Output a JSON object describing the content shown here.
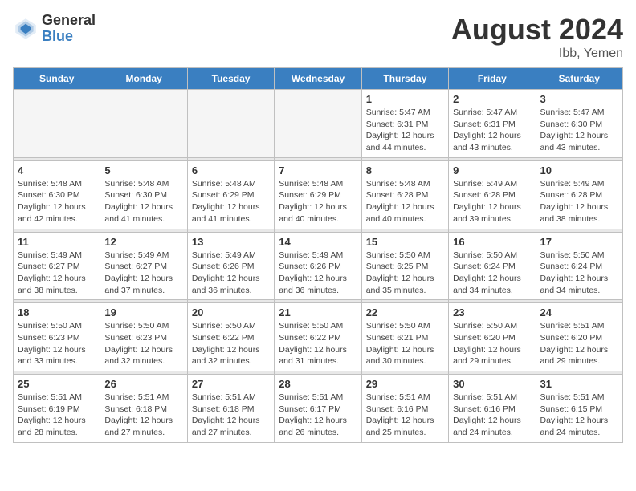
{
  "logo": {
    "general": "General",
    "blue": "Blue"
  },
  "title": "August 2024",
  "subtitle": "Ibb, Yemen",
  "weekdays": [
    "Sunday",
    "Monday",
    "Tuesday",
    "Wednesday",
    "Thursday",
    "Friday",
    "Saturday"
  ],
  "weeks": [
    {
      "days": [
        {
          "num": "",
          "empty": true
        },
        {
          "num": "",
          "empty": true
        },
        {
          "num": "",
          "empty": true
        },
        {
          "num": "",
          "empty": true
        },
        {
          "num": "1",
          "sunrise": "5:47 AM",
          "sunset": "6:31 PM",
          "daylight": "12 hours and 44 minutes."
        },
        {
          "num": "2",
          "sunrise": "5:47 AM",
          "sunset": "6:31 PM",
          "daylight": "12 hours and 43 minutes."
        },
        {
          "num": "3",
          "sunrise": "5:47 AM",
          "sunset": "6:30 PM",
          "daylight": "12 hours and 43 minutes."
        }
      ]
    },
    {
      "days": [
        {
          "num": "4",
          "sunrise": "5:48 AM",
          "sunset": "6:30 PM",
          "daylight": "12 hours and 42 minutes."
        },
        {
          "num": "5",
          "sunrise": "5:48 AM",
          "sunset": "6:30 PM",
          "daylight": "12 hours and 41 minutes."
        },
        {
          "num": "6",
          "sunrise": "5:48 AM",
          "sunset": "6:29 PM",
          "daylight": "12 hours and 41 minutes."
        },
        {
          "num": "7",
          "sunrise": "5:48 AM",
          "sunset": "6:29 PM",
          "daylight": "12 hours and 40 minutes."
        },
        {
          "num": "8",
          "sunrise": "5:48 AM",
          "sunset": "6:28 PM",
          "daylight": "12 hours and 40 minutes."
        },
        {
          "num": "9",
          "sunrise": "5:49 AM",
          "sunset": "6:28 PM",
          "daylight": "12 hours and 39 minutes."
        },
        {
          "num": "10",
          "sunrise": "5:49 AM",
          "sunset": "6:28 PM",
          "daylight": "12 hours and 38 minutes."
        }
      ]
    },
    {
      "days": [
        {
          "num": "11",
          "sunrise": "5:49 AM",
          "sunset": "6:27 PM",
          "daylight": "12 hours and 38 minutes."
        },
        {
          "num": "12",
          "sunrise": "5:49 AM",
          "sunset": "6:27 PM",
          "daylight": "12 hours and 37 minutes."
        },
        {
          "num": "13",
          "sunrise": "5:49 AM",
          "sunset": "6:26 PM",
          "daylight": "12 hours and 36 minutes."
        },
        {
          "num": "14",
          "sunrise": "5:49 AM",
          "sunset": "6:26 PM",
          "daylight": "12 hours and 36 minutes."
        },
        {
          "num": "15",
          "sunrise": "5:50 AM",
          "sunset": "6:25 PM",
          "daylight": "12 hours and 35 minutes."
        },
        {
          "num": "16",
          "sunrise": "5:50 AM",
          "sunset": "6:24 PM",
          "daylight": "12 hours and 34 minutes."
        },
        {
          "num": "17",
          "sunrise": "5:50 AM",
          "sunset": "6:24 PM",
          "daylight": "12 hours and 34 minutes."
        }
      ]
    },
    {
      "days": [
        {
          "num": "18",
          "sunrise": "5:50 AM",
          "sunset": "6:23 PM",
          "daylight": "12 hours and 33 minutes."
        },
        {
          "num": "19",
          "sunrise": "5:50 AM",
          "sunset": "6:23 PM",
          "daylight": "12 hours and 32 minutes."
        },
        {
          "num": "20",
          "sunrise": "5:50 AM",
          "sunset": "6:22 PM",
          "daylight": "12 hours and 32 minutes."
        },
        {
          "num": "21",
          "sunrise": "5:50 AM",
          "sunset": "6:22 PM",
          "daylight": "12 hours and 31 minutes."
        },
        {
          "num": "22",
          "sunrise": "5:50 AM",
          "sunset": "6:21 PM",
          "daylight": "12 hours and 30 minutes."
        },
        {
          "num": "23",
          "sunrise": "5:50 AM",
          "sunset": "6:20 PM",
          "daylight": "12 hours and 29 minutes."
        },
        {
          "num": "24",
          "sunrise": "5:51 AM",
          "sunset": "6:20 PM",
          "daylight": "12 hours and 29 minutes."
        }
      ]
    },
    {
      "days": [
        {
          "num": "25",
          "sunrise": "5:51 AM",
          "sunset": "6:19 PM",
          "daylight": "12 hours and 28 minutes."
        },
        {
          "num": "26",
          "sunrise": "5:51 AM",
          "sunset": "6:18 PM",
          "daylight": "12 hours and 27 minutes."
        },
        {
          "num": "27",
          "sunrise": "5:51 AM",
          "sunset": "6:18 PM",
          "daylight": "12 hours and 27 minutes."
        },
        {
          "num": "28",
          "sunrise": "5:51 AM",
          "sunset": "6:17 PM",
          "daylight": "12 hours and 26 minutes."
        },
        {
          "num": "29",
          "sunrise": "5:51 AM",
          "sunset": "6:16 PM",
          "daylight": "12 hours and 25 minutes."
        },
        {
          "num": "30",
          "sunrise": "5:51 AM",
          "sunset": "6:16 PM",
          "daylight": "12 hours and 24 minutes."
        },
        {
          "num": "31",
          "sunrise": "5:51 AM",
          "sunset": "6:15 PM",
          "daylight": "12 hours and 24 minutes."
        }
      ]
    }
  ]
}
